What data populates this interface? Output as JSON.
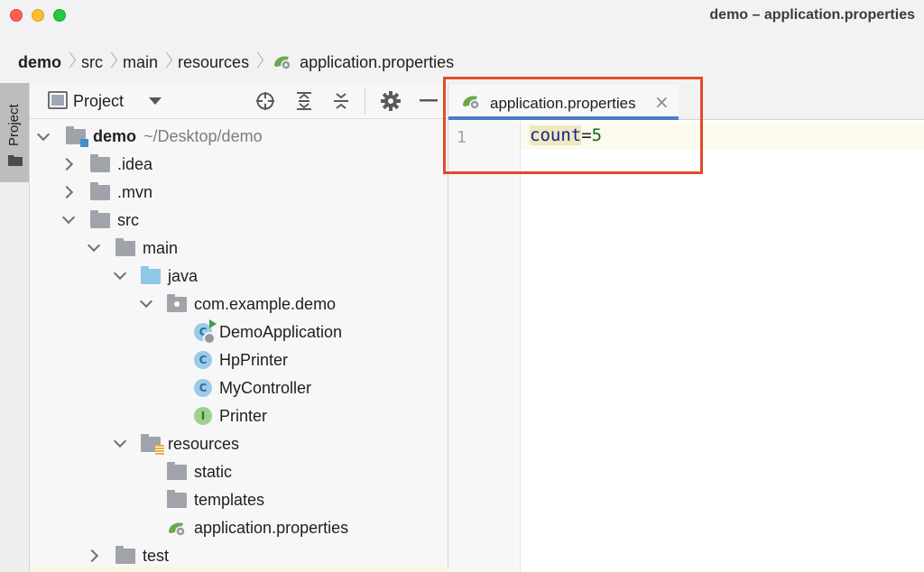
{
  "window": {
    "title": "demo – application.properties"
  },
  "breadcrumb": [
    "demo",
    "src",
    "main",
    "resources",
    "application.properties"
  ],
  "tool_strip": {
    "label": "Project"
  },
  "project_panel": {
    "title": "Project",
    "tree": [
      {
        "label": "demo",
        "path": "~/Desktop/demo"
      },
      {
        "label": ".idea"
      },
      {
        "label": ".mvn"
      },
      {
        "label": "src"
      },
      {
        "label": "main"
      },
      {
        "label": "java"
      },
      {
        "label": "com.example.demo"
      },
      {
        "label": "DemoApplication"
      },
      {
        "label": "HpPrinter"
      },
      {
        "label": "MyController"
      },
      {
        "label": "Printer"
      },
      {
        "label": "resources"
      },
      {
        "label": "static"
      },
      {
        "label": "templates"
      },
      {
        "label": "application.properties"
      },
      {
        "label": "test"
      }
    ],
    "class_badge": "C",
    "interface_badge": "I"
  },
  "editor": {
    "tab_label": "application.properties",
    "tab_close": "×",
    "line_number": "1",
    "code": {
      "key": "count",
      "eq": "=",
      "value": "5"
    }
  },
  "colors": {
    "highlight_box": "#e04b2c",
    "tab_underline": "#4a7fc1"
  }
}
